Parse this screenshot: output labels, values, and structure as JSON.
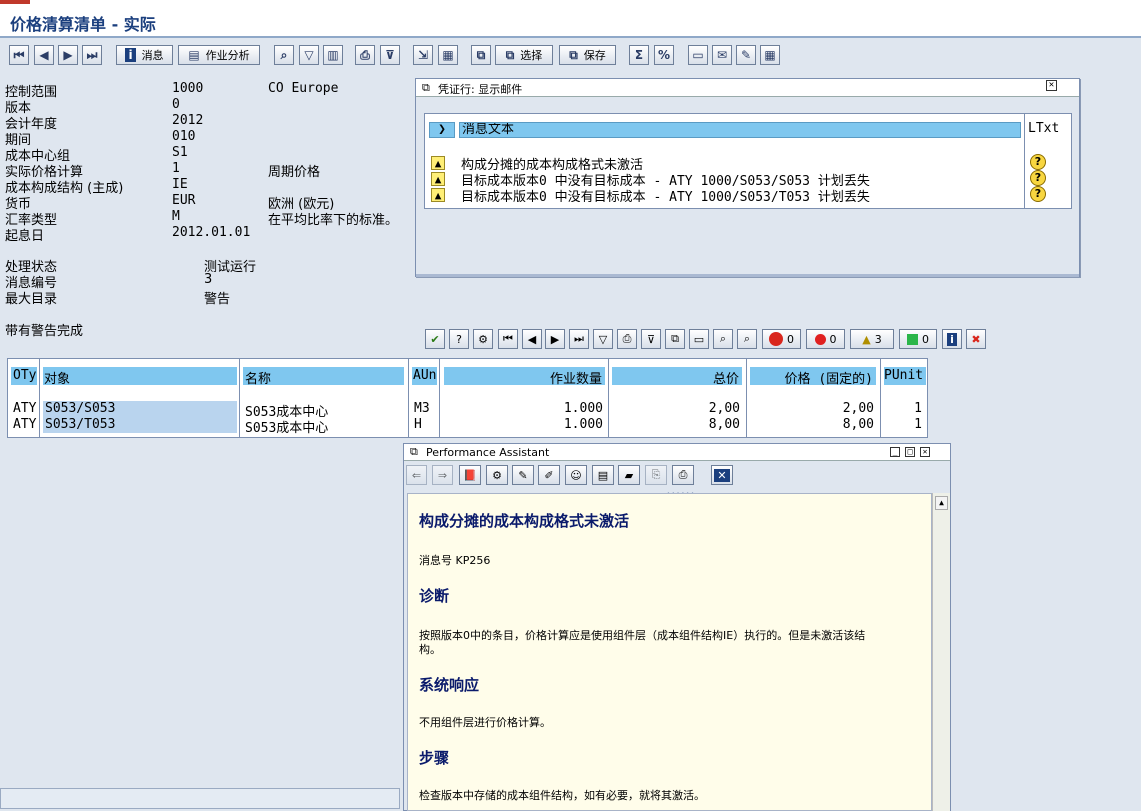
{
  "title": "价格清算清单 - 实际",
  "toolbar": {
    "messages_label": "消息",
    "activity_analysis_label": "作业分析",
    "select_label": "选择",
    "save_label": "保存"
  },
  "header_fields": [
    {
      "label": "控制范围",
      "value": "1000",
      "desc": "CO Europe"
    },
    {
      "label": "版本",
      "value": "0",
      "desc": ""
    },
    {
      "label": "会计年度",
      "value": "2012",
      "desc": ""
    },
    {
      "label": "期间",
      "value": "010",
      "desc": ""
    },
    {
      "label": "成本中心组",
      "value": "S1",
      "desc": ""
    },
    {
      "label": "实际价格计算",
      "value": "1",
      "desc": "周期价格"
    },
    {
      "label": "成本构成结构 (主成)",
      "value": "IE",
      "desc": ""
    },
    {
      "label": "货币",
      "value": "EUR",
      "desc": "欧洲 (欧元)"
    },
    {
      "label": "汇率类型",
      "value": "M",
      "desc": "在平均比率下的标准。"
    },
    {
      "label": "起息日",
      "value": "2012.01.01",
      "desc": ""
    }
  ],
  "status_fields": [
    {
      "label": "处理状态",
      "value": "测试运行"
    },
    {
      "label": "消息编号",
      "value": "3"
    },
    {
      "label": "最大目录",
      "value": "警告"
    }
  ],
  "completion_text": "带有警告完成",
  "popup": {
    "title": "凭证行: 显示邮件",
    "col_message": "消息文本",
    "col_ltxt": "LTxt",
    "messages": [
      "构成分摊的成本构成格式未激活",
      "目标成本版本0 中没有目标成本 - ATY 1000/S053/S053  计划丢失",
      "目标成本版本0 中没有目标成本 - ATY 1000/S053/T053  计划丢失"
    ],
    "counts": {
      "stop": "0",
      "error": "0",
      "warning": "3",
      "success": "0"
    }
  },
  "table": {
    "headers": [
      "OTy",
      "对象",
      "名称",
      "AUn",
      "作业数量",
      "总价",
      "价格 (固定的)",
      "PUnit"
    ],
    "rows": [
      [
        "ATY",
        "S053/S053",
        "S053成本中心",
        "M3",
        "1.000",
        "2,00",
        "2,00",
        "1"
      ],
      [
        "ATY",
        "S053/T053",
        "S053成本中心",
        "H",
        "1.000",
        "8,00",
        "8,00",
        "1"
      ]
    ]
  },
  "pa": {
    "title": "Performance Assistant",
    "heading": "构成分摊的成本构成格式未激活",
    "msg_no": "消息号 KP256",
    "diag_h": "诊断",
    "diag_p1": "按照版本0中的条目，价格计算应是使用组件层（成本组件结构IE）执行的。但是未激活该结",
    "diag_p2": "构。",
    "resp_h": "系统响应",
    "resp_p": "不用组件层进行价格计算。",
    "proc_h": "步骤",
    "proc_p": "检查版本中存储的成本组件结构，如有必要，就将其激活。"
  }
}
